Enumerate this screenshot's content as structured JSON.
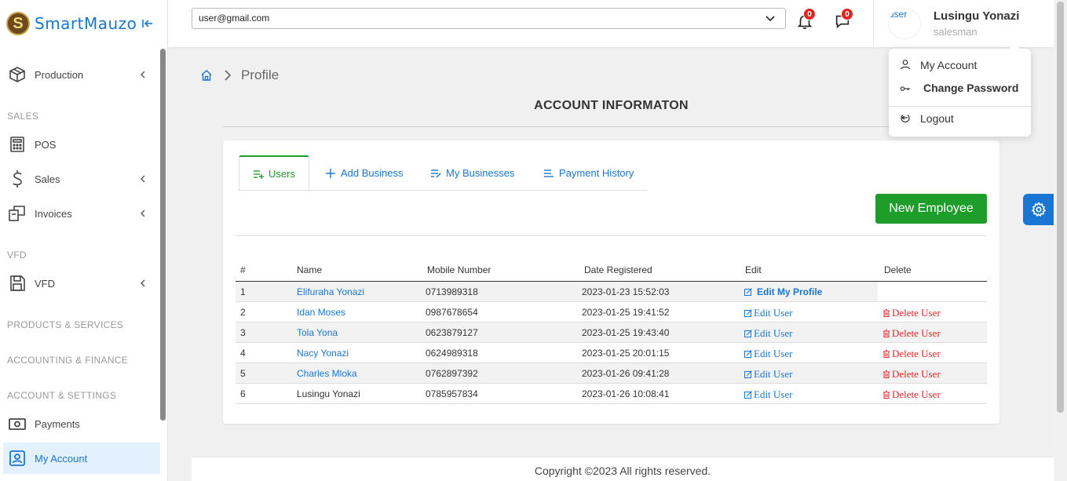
{
  "brand": {
    "logo_letter": "S",
    "name": "SmartMauzo"
  },
  "sidebar": {
    "items": [
      {
        "label": "Production",
        "icon": "box-icon",
        "has_children": true
      },
      {
        "label": "POS",
        "icon": "calculator-icon",
        "has_children": false
      },
      {
        "label": "Sales",
        "icon": "dollar-icon",
        "has_children": true
      },
      {
        "label": "Invoices",
        "icon": "invoice-icon",
        "has_children": true
      },
      {
        "label": "VFD",
        "icon": "save-icon",
        "has_children": true
      },
      {
        "label": "Payments",
        "icon": "money-icon",
        "has_children": false
      },
      {
        "label": "My Account",
        "icon": "account-icon",
        "has_children": false,
        "active": true
      }
    ],
    "sections": [
      "SALES",
      "VFD",
      "PRODUCTS & SERVICES",
      "ACCOUNTING & FINANCE",
      "ACCOUNT & SETTINGS"
    ]
  },
  "header": {
    "business_select": {
      "value": "user@gmail.com"
    },
    "notifications_count": "0",
    "messages_count": "0",
    "user": {
      "avatar_alt": "user",
      "name": "Lusingu Yonazi",
      "role": "salesman"
    }
  },
  "user_menu": {
    "items": [
      {
        "label": "My Account",
        "icon": "user-icon"
      },
      {
        "label": "Change Password",
        "icon": "key-icon"
      },
      {
        "label": "Logout",
        "icon": "logout-icon"
      }
    ]
  },
  "breadcrumb": {
    "current": "Profile"
  },
  "page": {
    "title": "ACCOUNT INFORMATON"
  },
  "tabs": [
    {
      "label": "Users",
      "icon": "list-add-icon",
      "active": true
    },
    {
      "label": "Add Business",
      "icon": "plus-icon"
    },
    {
      "label": "My Businesses",
      "icon": "list-edit-icon"
    },
    {
      "label": "Payment History",
      "icon": "list-icon"
    }
  ],
  "actions": {
    "new_employee": "New Employee"
  },
  "table": {
    "headers": [
      "#",
      "Name",
      "Mobile Number",
      "Date Registered",
      "Edit",
      "Delete"
    ],
    "edit_self_label": "Edit My Profile",
    "edit_label": "Edit  User",
    "delete_label": "Delete  User",
    "rows": [
      {
        "num": "1",
        "name": "Elifuraha Yonazi",
        "mobile": "0713989318",
        "date": "2023-01-23 15:52:03",
        "is_self": true,
        "name_link": true
      },
      {
        "num": "2",
        "name": "Idan Moses",
        "mobile": "0987678654",
        "date": "2023-01-25 19:41:52",
        "is_self": false,
        "name_link": true
      },
      {
        "num": "3",
        "name": "Tola Yona",
        "mobile": "0623879127",
        "date": "2023-01-25 19:43:40",
        "is_self": false,
        "name_link": true
      },
      {
        "num": "4",
        "name": "Nacy Yonazi",
        "mobile": "0624989318",
        "date": "2023-01-25 20:01:15",
        "is_self": false,
        "name_link": true
      },
      {
        "num": "5",
        "name": "Charles Mloka",
        "mobile": "0762897392",
        "date": "2023-01-26 09:41:28",
        "is_self": false,
        "name_link": true
      },
      {
        "num": "6",
        "name": "Lusingu Yonazi",
        "mobile": "0785957834",
        "date": "2023-01-26 10:08:41",
        "is_self": false,
        "name_link": false
      }
    ]
  },
  "footer": {
    "text": "Copyright ©2023 All rights reserved."
  },
  "colors": {
    "primary": "#1976d2",
    "success": "#1f9d2a",
    "danger": "#e02424"
  }
}
